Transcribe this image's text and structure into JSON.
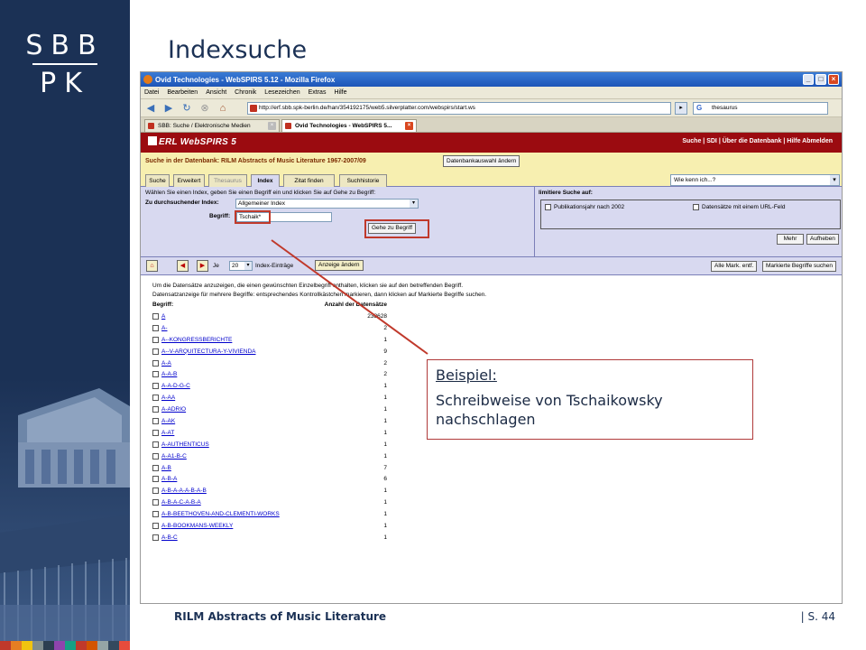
{
  "slide": {
    "title": "Indexsuche",
    "logo_top": "SBB",
    "logo_bottom": "PK",
    "footer_title": "RILM Abstracts of Music Literature",
    "footer_page": "| S. 44",
    "strip_colors": [
      "#c0392b",
      "#e67e22",
      "#f1c40f",
      "#7f8c8d",
      "#2c3e50",
      "#8e44ad",
      "#16a085",
      "#c0392b",
      "#d35400",
      "#95a5a6",
      "#34495e",
      "#e74c3c"
    ]
  },
  "browser": {
    "window_title": "Ovid Technologies - WebSPIRS 5.12 - Mozilla Firefox",
    "menu": [
      "Datei",
      "Bearbeiten",
      "Ansicht",
      "Chronik",
      "Lesezeichen",
      "Extras",
      "Hilfe"
    ],
    "url": "http://erf.sbb.spk-berlin.de/han/354192175/web5.silverplatter.com/webspirs/start.ws",
    "search_value": "thesaurus",
    "tabs": [
      {
        "label": "SBB: Suche / Elektronische Medien",
        "active": false
      },
      {
        "label": "Ovid Technologies - WebSPIRS 5...",
        "active": true
      }
    ]
  },
  "app": {
    "brand": "ERL WebSPIRS 5",
    "top_links": "Suche | SDI | Über die Datenbank | Hilfe    Abmelden",
    "db_label": "Suche in der Datenbank: RILM Abstracts of Music Literature 1967-2007/09",
    "db_change_button": "Datenbankauswahl ändern",
    "search_tabs": [
      "Suche",
      "Erweitert",
      "Thesaurus",
      "Index",
      "Zitat finden",
      "Suchhistorie"
    ],
    "help_select": "Wie kenn ich...?",
    "instruction": "Wählen Sie einen Index, geben Sie einen Begriff ein und klicken Sie auf Gehe zu Begriff:",
    "index_label": "Zu durchsuchender Index:",
    "index_value": "Allgemeiner Index",
    "term_label": "Begriff:",
    "term_value": "Tschaik*",
    "go_button": "Gehe zu Begriff",
    "limit_title": "limitiere Suche auf:",
    "limit_opt1": "Publikationsjahr nach 2002",
    "limit_opt2": "Datensätze mit einem URL-Feld",
    "more_button": "Mehr",
    "clear_button": "Aufheben",
    "per_page_label": "Je",
    "per_page_value": "20",
    "per_page_suffix": "Index-Einträge",
    "display_change_button": "Anzeige ändern",
    "unmark_all_button": "Alle Mark. entf.",
    "search_marked_button": "Markierte Begriffe suchen",
    "result_instr1": "Um die Datensätze anzuzeigen, die einen gewünschten Einzelbegriff enthalten, klicken sie auf den betreffenden Begriff.",
    "result_instr2": "Datensatzanzeige für mehrere Begriffe: entsprechendes Kontrollkästchen markieren, dann klicken auf  Markierte Begriffe suchen.",
    "col_term": "Begriff:",
    "col_count": "Anzahl der Datensätze",
    "rows": [
      {
        "term": "A",
        "count": "238628"
      },
      {
        "term": "A-",
        "count": "2"
      },
      {
        "term": "A--KONGRESSBERICHTE",
        "count": "1"
      },
      {
        "term": "A--V-ARQUITECTURA-Y-VIVIENDA",
        "count": "9"
      },
      {
        "term": "A-A",
        "count": "2"
      },
      {
        "term": "A-A-B",
        "count": "2"
      },
      {
        "term": "A-A-D-G-C",
        "count": "1"
      },
      {
        "term": "A-AA",
        "count": "1"
      },
      {
        "term": "A-ADRIO",
        "count": "1"
      },
      {
        "term": "A-AK",
        "count": "1"
      },
      {
        "term": "A-AT",
        "count": "1"
      },
      {
        "term": "A-AUTHENTICUS",
        "count": "1"
      },
      {
        "term": "A-A1-B-C",
        "count": "1"
      },
      {
        "term": "A-B",
        "count": "7"
      },
      {
        "term": "A-B-A",
        "count": "6"
      },
      {
        "term": "A-B-A-A-A-B-A-B",
        "count": "1"
      },
      {
        "term": "A-B-A-C-A-B-A",
        "count": "1"
      },
      {
        "term": "A-B-BEETHOVEN-AND-CLEMENTI-WORKS",
        "count": "1"
      },
      {
        "term": "A-B-BOOKMANS-WEEKLY",
        "count": "1"
      },
      {
        "term": "A-B-C",
        "count": "1"
      }
    ]
  },
  "callout": {
    "heading": "Beispiel:",
    "text": "Schreibweise von Tschaikowsky nachschlagen"
  }
}
